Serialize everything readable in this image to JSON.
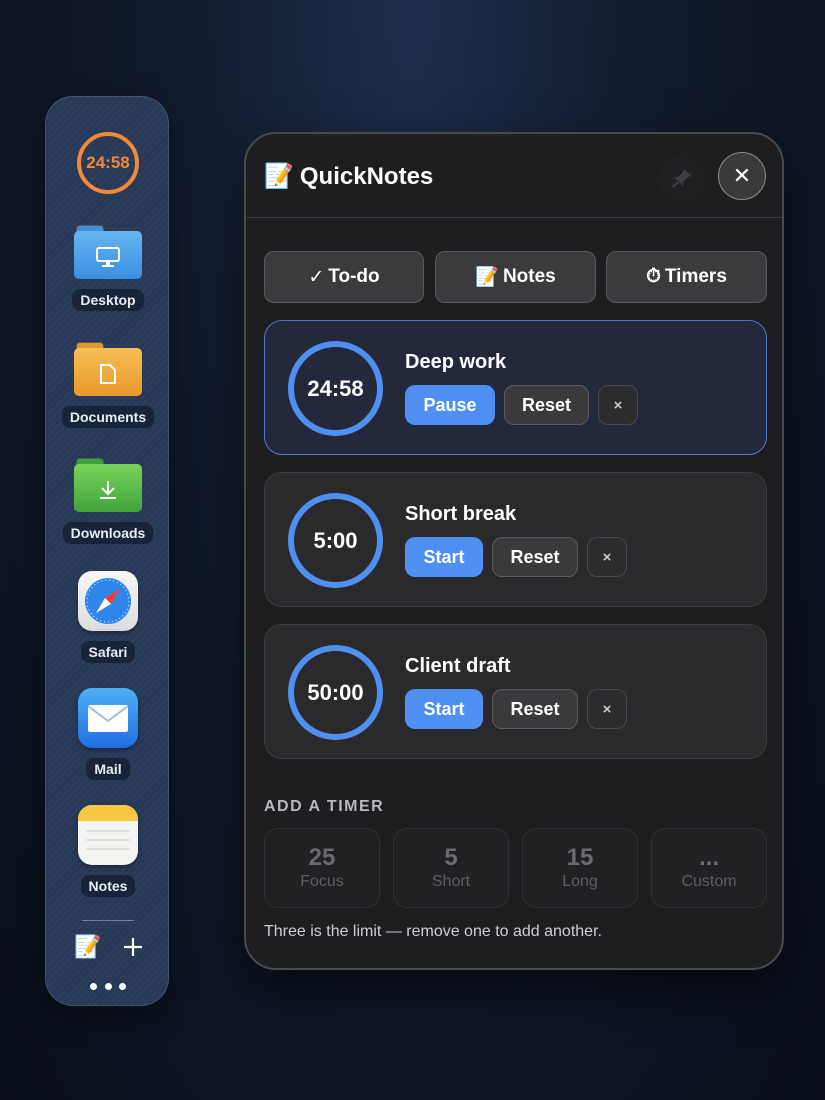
{
  "dock": {
    "timer_display": "24:58",
    "items": [
      {
        "label": "Desktop"
      },
      {
        "label": "Documents"
      },
      {
        "label": "Downloads"
      },
      {
        "label": "Safari"
      },
      {
        "label": "Mail"
      },
      {
        "label": "Notes"
      }
    ],
    "colors": {
      "accent": "#f08a38"
    }
  },
  "panel": {
    "emoji": "📝",
    "title": "QuickNotes",
    "close_glyph": "✕",
    "tabs": [
      {
        "icon": "✓",
        "label": "To-do"
      },
      {
        "icon": "📝",
        "label": "Notes"
      },
      {
        "icon": "⏱",
        "label": "Timers"
      }
    ],
    "timers": [
      {
        "name": "Deep work",
        "time": "24:58",
        "primary": "Pause",
        "secondary": "Reset",
        "remove": "×",
        "active": true
      },
      {
        "name": "Short break",
        "time": "5:00",
        "primary": "Start",
        "secondary": "Reset",
        "remove": "×",
        "active": false
      },
      {
        "name": "Client draft",
        "time": "50:00",
        "primary": "Start",
        "secondary": "Reset",
        "remove": "×",
        "active": false
      }
    ],
    "add_heading": "ADD A TIMER",
    "presets": [
      {
        "value": "25",
        "label": "Focus"
      },
      {
        "value": "5",
        "label": "Short"
      },
      {
        "value": "15",
        "label": "Long"
      },
      {
        "value": "...",
        "label": "Custom"
      }
    ],
    "footer_note": "Three is the limit — remove one to add another.",
    "colors": {
      "accent": "#4f8ff2",
      "panel_bg": "#1e1e20"
    }
  }
}
